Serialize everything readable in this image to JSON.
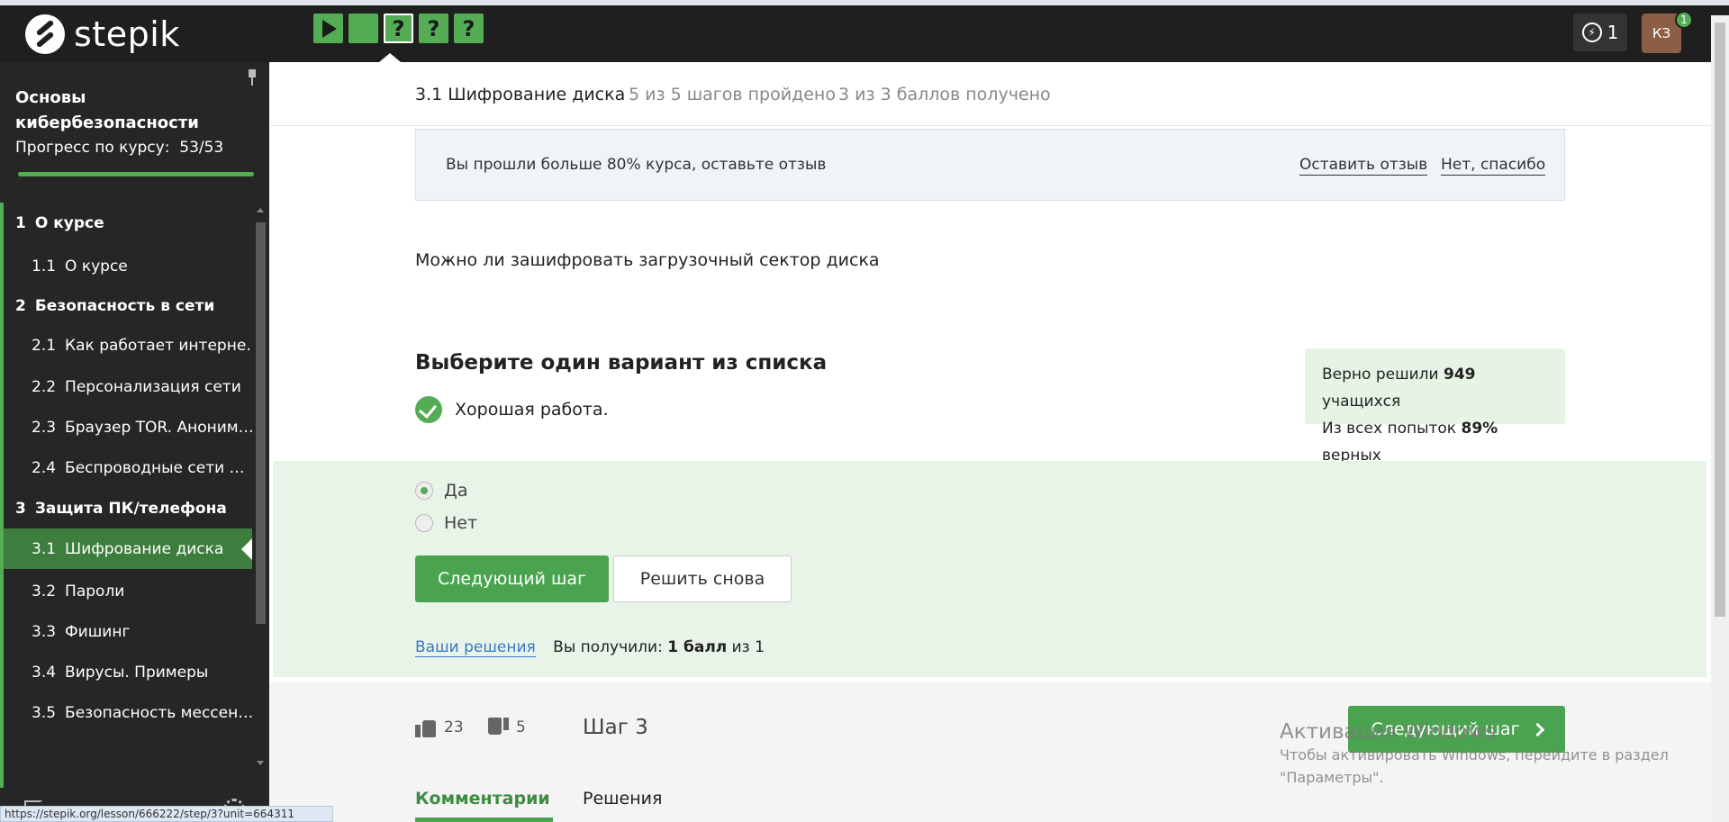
{
  "topbar": {
    "logo_text": "stepik",
    "steps": [
      {
        "type": "video",
        "status": "passed"
      },
      {
        "type": "text",
        "status": "passed"
      },
      {
        "type": "quiz",
        "label": "?",
        "status": "current"
      },
      {
        "type": "quiz",
        "label": "?",
        "status": "passed"
      },
      {
        "type": "quiz",
        "label": "?",
        "status": "passed"
      }
    ],
    "energy_count": "1",
    "avatar_initials": "КЗ",
    "notification_count": "1"
  },
  "sidebar": {
    "course_title": "Основы кибербезопасности",
    "progress_label": "Прогресс по курсу:",
    "progress_value": "53/53",
    "progress_fraction": 1.0,
    "toc": [
      {
        "kind": "section",
        "num": "1",
        "label": "О курсе"
      },
      {
        "kind": "lesson",
        "num": "1.1",
        "label": "О курсе"
      },
      {
        "kind": "section",
        "num": "2",
        "label": "Безопасность в сети"
      },
      {
        "kind": "lesson",
        "num": "2.1",
        "label": "Как работает интерне…"
      },
      {
        "kind": "lesson",
        "num": "2.2",
        "label": "Персонализация сети"
      },
      {
        "kind": "lesson",
        "num": "2.3",
        "label": "Браузер TOR. Аноним…"
      },
      {
        "kind": "lesson",
        "num": "2.4",
        "label": "Беспроводные сети …"
      },
      {
        "kind": "section",
        "num": "3",
        "label": "Защита ПК/телефона"
      },
      {
        "kind": "lesson",
        "num": "3.1",
        "label": "Шифрование диска",
        "current": true
      },
      {
        "kind": "lesson",
        "num": "3.2",
        "label": "Пароли"
      },
      {
        "kind": "lesson",
        "num": "3.3",
        "label": "Фишинг"
      },
      {
        "kind": "lesson",
        "num": "3.4",
        "label": "Вирусы. Примеры"
      },
      {
        "kind": "lesson",
        "num": "3.5",
        "label": "Безопасность мессен…"
      }
    ]
  },
  "lesson_header": {
    "title": "3.1 Шифрование диска",
    "steps_done": "5 из 5 шагов пройдено",
    "score": "3 из 3 баллов  получено"
  },
  "review_banner": {
    "text": "Вы прошли больше 80% курса, оставьте отзыв",
    "leave_label": "Оставить отзыв",
    "decline_label": "Нет, спасибо"
  },
  "quiz": {
    "question": "Можно ли зашифровать загрузочный сектор диска",
    "choose_title": "Выберите один вариант из списка",
    "feedback": "Хорошая работа.",
    "stats": {
      "solved_prefix": "Верно решили ",
      "solved_count": "949",
      "solved_suffix": " учащихся",
      "attempts_prefix": "Из всех попыток ",
      "attempts_pct": "89%",
      "attempts_suffix": " верных"
    },
    "options": [
      {
        "label": "Да",
        "checked": true
      },
      {
        "label": "Нет",
        "checked": false
      }
    ],
    "next_label": "Следующий шаг",
    "retry_label": "Решить снова",
    "solutions_link": "Ваши решения",
    "received_prefix": "Вы получили: ",
    "received_points": "1 балл",
    "received_suffix": " из 1"
  },
  "footer": {
    "likes": "23",
    "dislikes": "5",
    "step_label": "Шаг 3",
    "next_label": "Следующий шаг",
    "tabs": [
      {
        "label": "Комментарии",
        "active": true
      },
      {
        "label": "Решения",
        "active": false
      }
    ]
  },
  "watermark": {
    "title": "Активация Windows",
    "subtitle": "Чтобы активировать Windows, перейдите в раздел \"Параметры\"."
  },
  "statusbar": {
    "url": "https://stepik.org/lesson/666222/step/3?unit=664311"
  },
  "colors": {
    "accent_green": "#4aa34f",
    "sidebar_bg": "#262626",
    "topbar_bg": "#1f1f1f",
    "link_blue": "#3a76c9"
  }
}
